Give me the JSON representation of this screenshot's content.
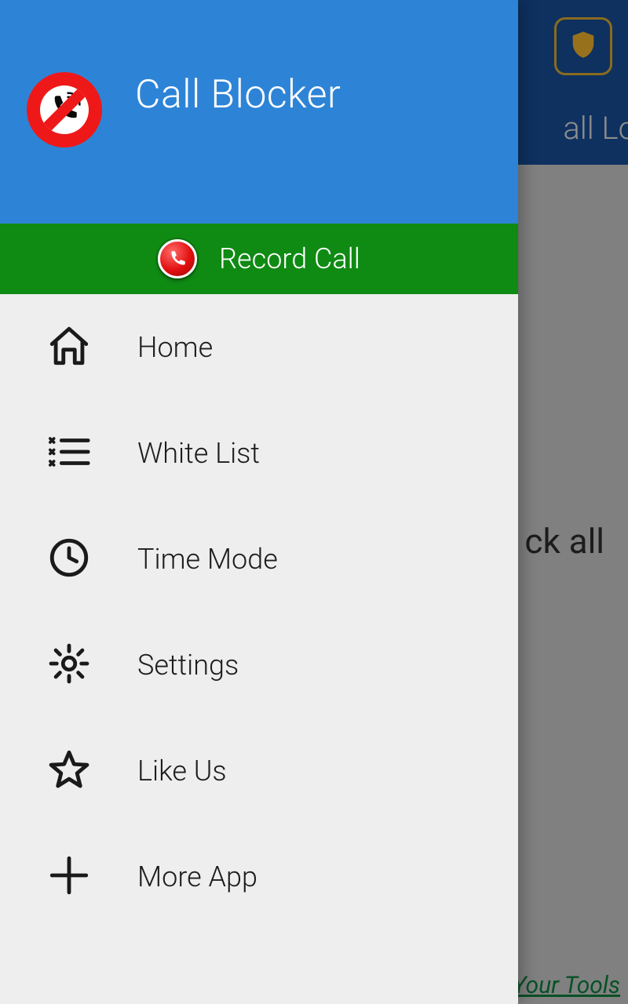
{
  "drawer": {
    "title": "Call Blocker",
    "record_label": "Record Call",
    "items": [
      {
        "label": "Home"
      },
      {
        "label": "White List"
      },
      {
        "label": "Time Mode"
      },
      {
        "label": "Settings"
      },
      {
        "label": "Like Us"
      },
      {
        "label": "More App"
      }
    ]
  },
  "background": {
    "tab_text": "all Lo",
    "mid_text": "ck all",
    "bottom_link": "Your Tools"
  }
}
